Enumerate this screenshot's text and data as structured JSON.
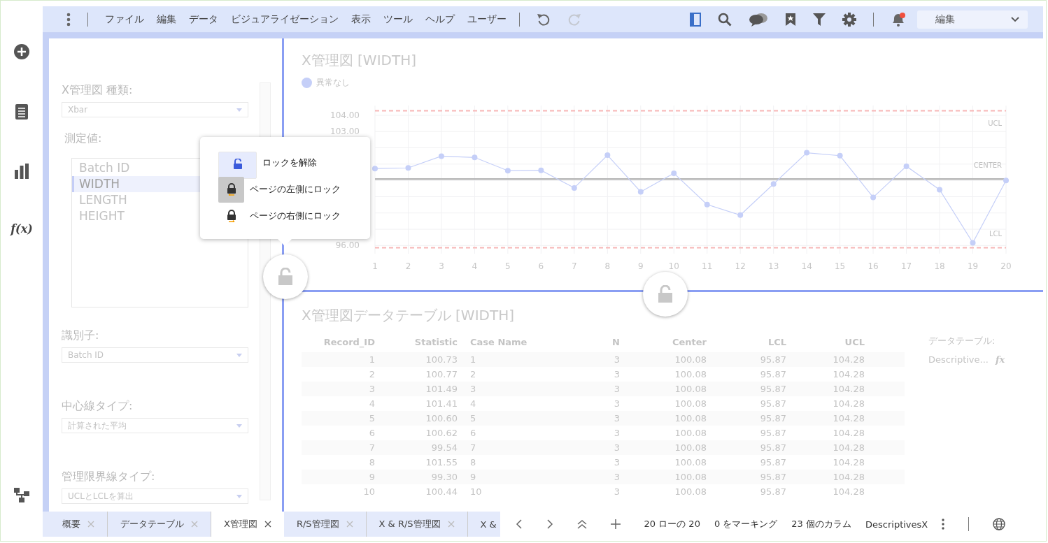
{
  "menu_bar": {
    "items": [
      "ファイル",
      "編集",
      "データ",
      "ビジュアライゼーション",
      "表示",
      "ツール",
      "ヘルプ",
      "ユーザー"
    ],
    "history_buttons": [
      {
        "kind": "undo",
        "disabled": false
      },
      {
        "kind": "redo",
        "disabled": true
      }
    ],
    "mode_dropdown": {
      "value": "編集"
    }
  },
  "rail": {
    "function_label": "f(x)"
  },
  "settings_panel": {
    "chart_type_label": "X管理図 種類:",
    "chart_type": "Xbar",
    "measure_label": "測定値:",
    "measures": [
      {
        "label": "Batch ID",
        "selected": false
      },
      {
        "label": "WIDTH",
        "selected": true
      },
      {
        "label": "LENGTH",
        "selected": false
      },
      {
        "label": "HEIGHT",
        "selected": false
      }
    ],
    "identifier_label": "識別子:",
    "identifier": "Batch ID",
    "center_label": "中心線タイプ:",
    "center_type": "計算された平均",
    "limit_label": "管理限界線タイプ:",
    "limit_type": "UCLとLCLを算出"
  },
  "lock_menu": {
    "items": [
      {
        "kind": "unlock",
        "label": "ロックを解除",
        "selected": true,
        "hovered": false
      },
      {
        "kind": "lock-left",
        "label": "ページの左側にロック",
        "selected": false,
        "hovered": true
      },
      {
        "kind": "lock-right",
        "label": "ページの右側にロック",
        "selected": false,
        "hovered": false
      }
    ]
  },
  "chart_panel": {
    "chart_data": {
      "type": "line",
      "title": "X管理図 [WIDTH]",
      "x": [
        1,
        2,
        3,
        4,
        5,
        6,
        7,
        8,
        9,
        10,
        11,
        12,
        13,
        14,
        15,
        16,
        17,
        18,
        19,
        20
      ],
      "series": [
        {
          "name": "異常なし",
          "color": "#c5cff8",
          "values": [
            100.73,
            100.77,
            101.49,
            101.41,
            100.6,
            100.62,
            99.54,
            101.55,
            99.3,
            100.44,
            98.52,
            97.87,
            99.78,
            101.7,
            101.52,
            98.96,
            100.87,
            99.43,
            96.17,
            100.0
          ]
        }
      ],
      "xlim": [
        1,
        20
      ],
      "ylim": [
        95.5,
        104.6
      ],
      "grid": true,
      "marker": "circle",
      "yticks": [
        {
          "value": 96,
          "label": "96.00"
        },
        {
          "value": 103,
          "label": "103.00"
        },
        {
          "value": 104,
          "label": "104.00"
        }
      ],
      "xticks": [
        1,
        2,
        3,
        4,
        5,
        6,
        7,
        8,
        9,
        10,
        11,
        12,
        13,
        14,
        15,
        16,
        17,
        18,
        19,
        20
      ],
      "ref_lines": [
        {
          "axis": "y",
          "value": 104.28,
          "label": "UCL",
          "color": "#f7b6b6"
        },
        {
          "axis": "y",
          "value": 100.08,
          "label": "CENTER",
          "color": "#b8b8b8"
        },
        {
          "axis": "y",
          "value": 95.87,
          "label": "LCL",
          "color": "#f7b6b6"
        }
      ]
    }
  },
  "table_panel": {
    "title": "X管理図データテーブル [WIDTH]",
    "columns": [
      "Record_ID",
      "Statistic",
      "Case Name",
      "N",
      "Center",
      "LCL",
      "UCL"
    ],
    "rows": [
      [
        "1",
        "100.73",
        "1",
        "3",
        "100.08",
        "95.87",
        "104.28"
      ],
      [
        "2",
        "100.77",
        "2",
        "3",
        "100.08",
        "95.87",
        "104.28"
      ],
      [
        "3",
        "101.49",
        "3",
        "3",
        "100.08",
        "95.87",
        "104.28"
      ],
      [
        "4",
        "101.41",
        "4",
        "3",
        "100.08",
        "95.87",
        "104.28"
      ],
      [
        "5",
        "100.60",
        "5",
        "3",
        "100.08",
        "95.87",
        "104.28"
      ],
      [
        "6",
        "100.62",
        "6",
        "3",
        "100.08",
        "95.87",
        "104.28"
      ],
      [
        "7",
        "99.54",
        "7",
        "3",
        "100.08",
        "95.87",
        "104.28"
      ],
      [
        "8",
        "101.55",
        "8",
        "3",
        "100.08",
        "95.87",
        "104.28"
      ],
      [
        "9",
        "99.30",
        "9",
        "3",
        "100.08",
        "95.87",
        "104.28"
      ],
      [
        "10",
        "100.44",
        "10",
        "3",
        "100.08",
        "95.87",
        "104.28"
      ]
    ],
    "data_table_label": "データテーブル:",
    "data_table": "Descriptive...",
    "fx": "fx"
  },
  "tabs": [
    {
      "label": "概要",
      "selected": false
    },
    {
      "label": "データテーブル",
      "selected": false
    },
    {
      "label": "X管理図",
      "selected": true
    },
    {
      "label": "R/S管理図",
      "selected": false
    },
    {
      "label": "X & R/S管理図",
      "selected": false
    },
    {
      "label": "X &",
      "selected": false
    }
  ],
  "status_bar": {
    "rows": "20 ローの 20",
    "marked": "0 をマーキング",
    "columns": "23 個のカラム",
    "table": "DescriptivesX"
  }
}
